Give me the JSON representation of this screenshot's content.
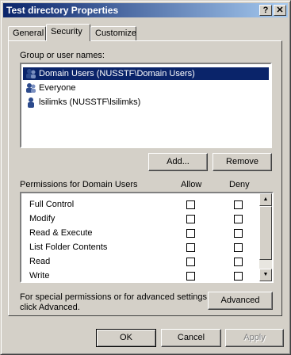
{
  "window": {
    "title": "Test directory Properties",
    "help_btn": "?",
    "close_btn": "✕"
  },
  "tabs": [
    {
      "label": "General"
    },
    {
      "label": "Security"
    },
    {
      "label": "Customize"
    }
  ],
  "groups": {
    "heading": "Group or user names:",
    "items": [
      {
        "label": "Domain Users (NUSSTF\\Domain Users)",
        "icon": "users-group-icon",
        "selected": true
      },
      {
        "label": "Everyone",
        "icon": "users-group-icon",
        "selected": false
      },
      {
        "label": "lsilimks (NUSSTF\\lsilimks)",
        "icon": "user-icon",
        "selected": false
      }
    ],
    "add_button": "Add...",
    "remove_button": "Remove"
  },
  "permissions": {
    "heading": "Permissions for Domain Users",
    "allow_header": "Allow",
    "deny_header": "Deny",
    "rows": [
      {
        "label": "Full Control",
        "allow": false,
        "deny": false
      },
      {
        "label": "Modify",
        "allow": false,
        "deny": false
      },
      {
        "label": "Read & Execute",
        "allow": false,
        "deny": false
      },
      {
        "label": "List Folder Contents",
        "allow": false,
        "deny": false
      },
      {
        "label": "Read",
        "allow": false,
        "deny": false
      },
      {
        "label": "Write",
        "allow": false,
        "deny": false
      }
    ]
  },
  "advanced": {
    "note_line1": "For special permissions or for advanced settings,",
    "note_line2": "click Advanced.",
    "button": "Advanced"
  },
  "footer": {
    "ok": "OK",
    "cancel": "Cancel",
    "apply": "Apply"
  }
}
